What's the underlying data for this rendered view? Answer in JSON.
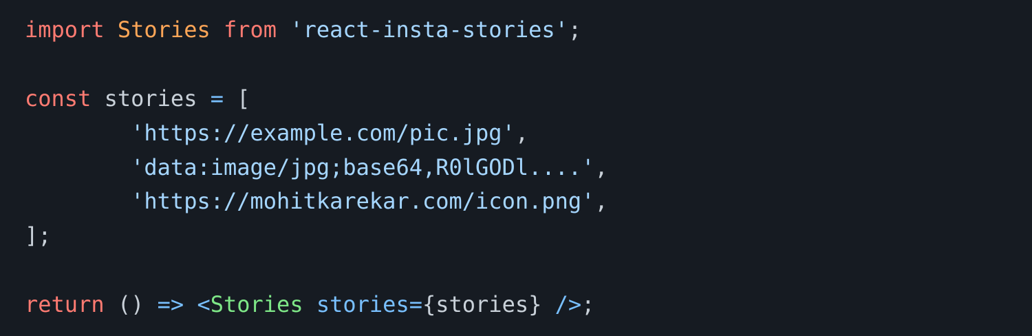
{
  "colors": {
    "background": "#161b22",
    "keyword": "#ff7b72",
    "identifier_import": "#ffa657",
    "string": "#a5d6ff",
    "operator": "#79c0ff",
    "jsx_tag": "#7ee787",
    "jsx_attr": "#79c0ff",
    "text": "#c9d1d9"
  },
  "code": {
    "line1": {
      "kw_import": "import",
      "ident": "Stories",
      "kw_from": "from",
      "module": "'react-insta-stories'",
      "semi": ";"
    },
    "line3": {
      "kw_const": "const",
      "var": "stories",
      "eq": "=",
      "open": "["
    },
    "line4": {
      "str": "'https://example.com/pic.jpg'",
      "comma": ","
    },
    "line5": {
      "str": "'data:image/jpg;base64,R0lGODl....'",
      "comma": ","
    },
    "line6": {
      "str": "'https://mohitkarekar.com/icon.png'",
      "comma": ","
    },
    "line7": {
      "close": "];"
    },
    "line9": {
      "kw_return": "return",
      "parens": "()",
      "arrow": "=>",
      "lt": "<",
      "tag": "Stories",
      "attr": "stories",
      "eq": "=",
      "expr": "{stories}",
      "selfclose": "/>",
      "semi": ";"
    }
  }
}
